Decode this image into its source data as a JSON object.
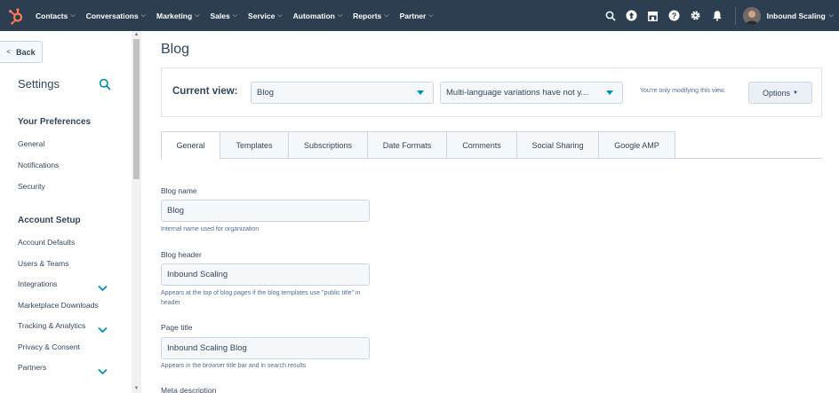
{
  "topnav": {
    "items": [
      {
        "label": "Contacts"
      },
      {
        "label": "Conversations"
      },
      {
        "label": "Marketing"
      },
      {
        "label": "Sales"
      },
      {
        "label": "Service"
      },
      {
        "label": "Automation"
      },
      {
        "label": "Reports"
      },
      {
        "label": "Partner"
      }
    ],
    "account_name": "Inbound Scaling",
    "icons": [
      "search-icon",
      "upgrade-icon",
      "marketplace-icon",
      "help-icon",
      "gear-icon",
      "bell-icon"
    ],
    "background": "#2d3e50",
    "brand_color": "#ff7a59"
  },
  "sidebar": {
    "back_label": "Back",
    "title": "Settings",
    "sections": [
      {
        "title": "Your Preferences",
        "items": [
          {
            "label": "General"
          },
          {
            "label": "Notifications"
          },
          {
            "label": "Security"
          }
        ]
      },
      {
        "title": "Account Setup",
        "items": [
          {
            "label": "Account Defaults"
          },
          {
            "label": "Users & Teams"
          },
          {
            "label": "Integrations"
          },
          {
            "label": "Marketplace Downloads"
          },
          {
            "label": "Tracking & Analytics"
          },
          {
            "label": "Privacy & Consent"
          },
          {
            "label": "Partners"
          }
        ]
      }
    ]
  },
  "main": {
    "title": "Blog",
    "current_view": {
      "label": "Current view:",
      "blog_select": "Blog",
      "language_select": "Multi-language variations have not y...",
      "note": "You're only modifying this view.",
      "options_label": "Options"
    },
    "tabs": [
      {
        "label": "General"
      },
      {
        "label": "Templates"
      },
      {
        "label": "Subscriptions"
      },
      {
        "label": "Date Formats"
      },
      {
        "label": "Comments"
      },
      {
        "label": "Social Sharing"
      },
      {
        "label": "Google AMP"
      }
    ],
    "fields": {
      "blog_name": {
        "label": "Blog name",
        "value": "Blog",
        "help": "Internal name used for organization"
      },
      "blog_header": {
        "label": "Blog header",
        "value": "Inbound Scaling",
        "help": "Appears at the top of blog pages if the blog templates use \"public title\" in header"
      },
      "page_title": {
        "label": "Page title",
        "value": "Inbound Scaling Blog",
        "help": "Appears in the browser title bar and in search results"
      },
      "meta_description": {
        "label": "Meta description"
      }
    }
  },
  "colors": {
    "accent": "#0091ae",
    "text": "#33475b",
    "border": "#cbd6e2"
  }
}
